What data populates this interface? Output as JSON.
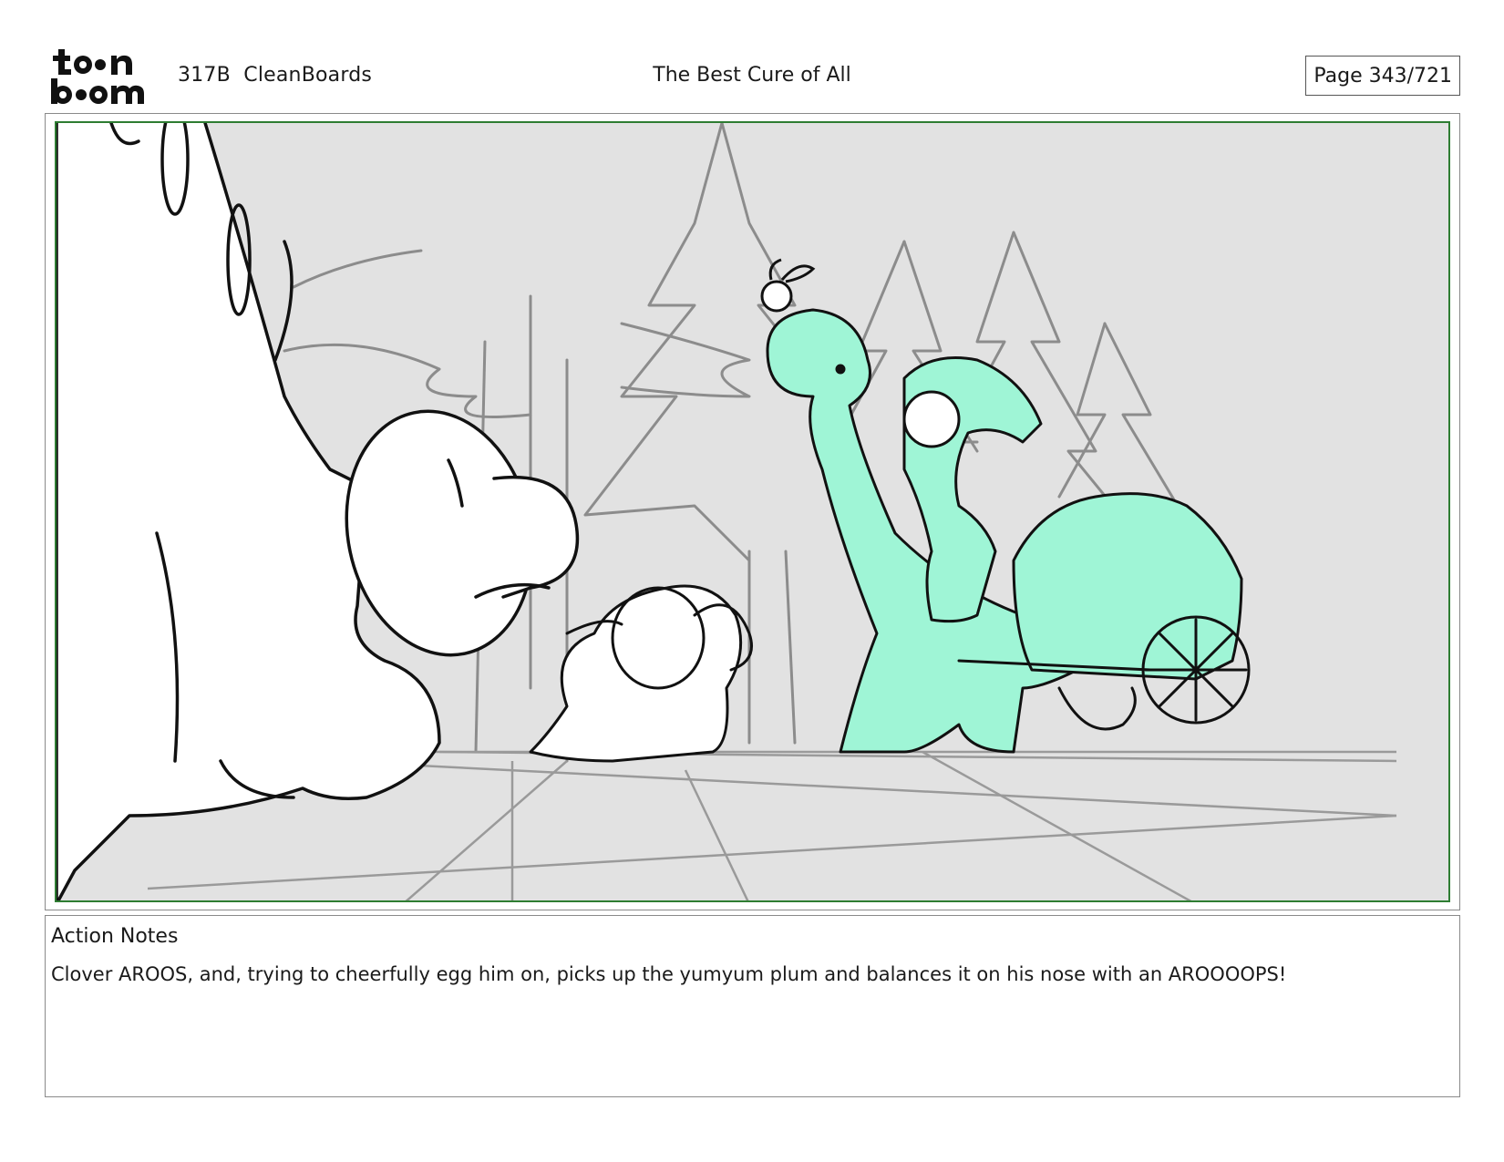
{
  "header": {
    "logo_text": "toon boom",
    "project": "317B  CleanBoards",
    "title": "The Best Cure of All",
    "page": "Page 343/721"
  },
  "panel": {
    "frame_color": "#2e7d32",
    "background_color": "#e2e2e2",
    "highlight_color": "#9ff5d6"
  },
  "notes": {
    "heading": "Action Notes",
    "text": "Clover AROOS, and, trying to cheerfully egg him on, picks up the yumyum plum and balances it on his nose with an AROOOOPS!"
  }
}
